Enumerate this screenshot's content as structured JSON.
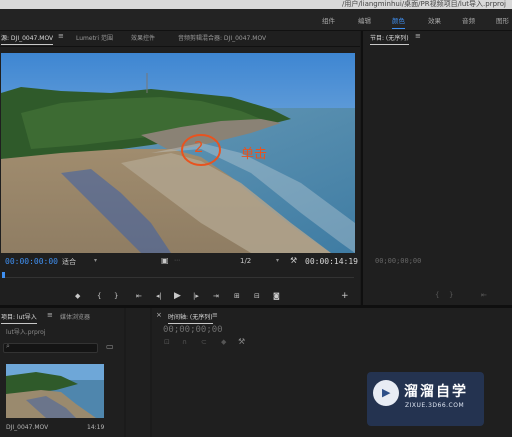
{
  "title_bar": {
    "path": "/用户/liangminhui/桌面/PR视频项目/lut导入.prproj"
  },
  "workspaces": [
    "组件",
    "编辑",
    "颜色",
    "效果",
    "音频",
    "图形"
  ],
  "active_workspace": "颜色",
  "source_panel": {
    "tabs": [
      "源: DJI_0047.MOV",
      "Lumetri 范围",
      "效果控件",
      "音频剪辑混合器: DJI_0047.MOV"
    ],
    "timecode_current": "00:00:00:00",
    "fit": "适合",
    "resolution": "1/2",
    "timecode_duration": "00:00:14:19"
  },
  "annotation": {
    "number": "2",
    "label": "单击",
    "color": "#e8531f"
  },
  "program_panel": {
    "tab": "节目: (无序列)",
    "timecode": "00;00;00;00"
  },
  "project_panel": {
    "tabs": [
      "项目: lut导入",
      "媒体浏览器"
    ],
    "project_file": "lut导入.prproj",
    "clip_name": "DJI_0047.MOV",
    "clip_duration": "14:19"
  },
  "timeline_panel": {
    "tab": "时间轴: (无序列)",
    "timecode": "00;00;00;00"
  },
  "watermark": {
    "title": "溜溜自学",
    "url": "ZIXUE.3D66.COM"
  },
  "icons": {
    "marker": "marker-icon",
    "in": "mark-in-icon",
    "out": "mark-out-icon",
    "goto_in": "go-to-in-icon",
    "step_back": "step-back-icon",
    "play": "play-icon",
    "step_fwd": "step-forward-icon",
    "goto_out": "go-to-out-icon",
    "insert": "insert-icon",
    "overwrite": "overwrite-icon",
    "export_frame": "camera-icon",
    "add": "plus-icon",
    "wrench": "wrench-icon"
  },
  "colors": {
    "accent_blue": "#3f8ff0",
    "panel_bg": "#1f1f1f",
    "app_bg": "#1b1b1b"
  }
}
